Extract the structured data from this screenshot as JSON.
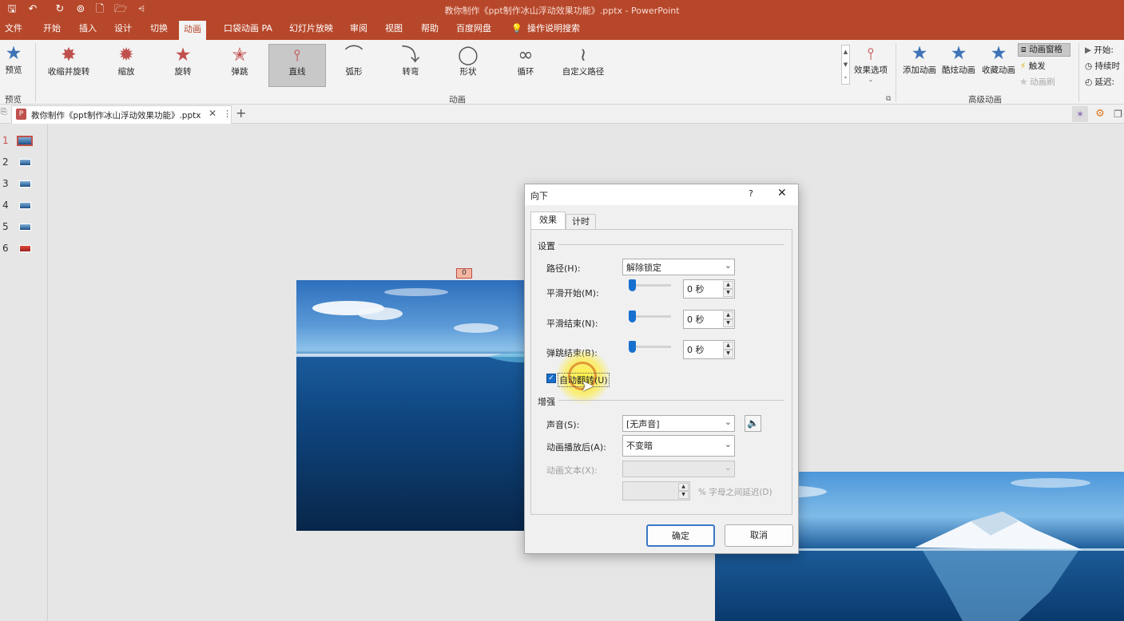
{
  "app": {
    "window_title": "教你制作《ppt制作冰山浮动效果功能》.pptx  -  PowerPoint"
  },
  "menu_tabs": [
    "文件",
    "开始",
    "插入",
    "设计",
    "切换",
    "动画",
    "口袋动画 PA",
    "幻灯片放映",
    "审阅",
    "视图",
    "帮助",
    "百度网盘"
  ],
  "tell_me": "操作说明搜索",
  "ribbon": {
    "preview_label": "预览",
    "preview_group": "预览",
    "animations": [
      "收缩并旋转",
      "缩放",
      "旋转",
      "弹跳",
      "直线",
      "弧形",
      "转弯",
      "形状",
      "循环",
      "自定义路径"
    ],
    "selected_animation": "直线",
    "animation_group": "动画",
    "effect_options": "效果选项",
    "add_animation": "添加动画",
    "cool_animation": "酷炫动画",
    "save_animation": "收藏动画",
    "animation_pane": "动画窗格",
    "trigger": "触发",
    "animation_painter": "动画刷",
    "advanced_group": "高级动画",
    "start_label": "开始:",
    "duration_label": "持续时",
    "delay_label": "延迟:"
  },
  "doc_tab": {
    "name": "教你制作《ppt制作冰山浮动效果功能》.pptx"
  },
  "slide_numbers": [
    "1",
    "2",
    "3",
    "4",
    "5",
    "6"
  ],
  "selected_slide": 1,
  "anim_marker": "0",
  "dialog": {
    "title": "向下",
    "help": "?",
    "tabs": [
      "效果",
      "计时"
    ],
    "settings_header": "设置",
    "path_label": "路径(H):",
    "path_value": "解除锁定",
    "smooth_start_label": "平滑开始(M):",
    "smooth_start_value": "0 秒",
    "smooth_end_label": "平滑结束(N):",
    "smooth_end_value": "0 秒",
    "bounce_end_label": "弹跳结束(B):",
    "bounce_end_value": "0 秒",
    "auto_reverse_label": "自动翻转(U)",
    "auto_reverse_checked": true,
    "enhance_header": "增强",
    "sound_label": "声音(S):",
    "sound_value": "[无声音]",
    "after_anim_label": "动画播放后(A):",
    "after_anim_value": "不变暗",
    "anim_text_label": "动画文本(X):",
    "anim_text_value": "",
    "letter_delay_label": "% 字母之间延迟(D)",
    "ok": "确定",
    "cancel": "取消"
  },
  "colors": {
    "accent": "#b7472a",
    "ribbon_bg": "#f3f3f3",
    "dialog_bg": "#f0f0f0",
    "primary_border": "#3a78c4"
  }
}
